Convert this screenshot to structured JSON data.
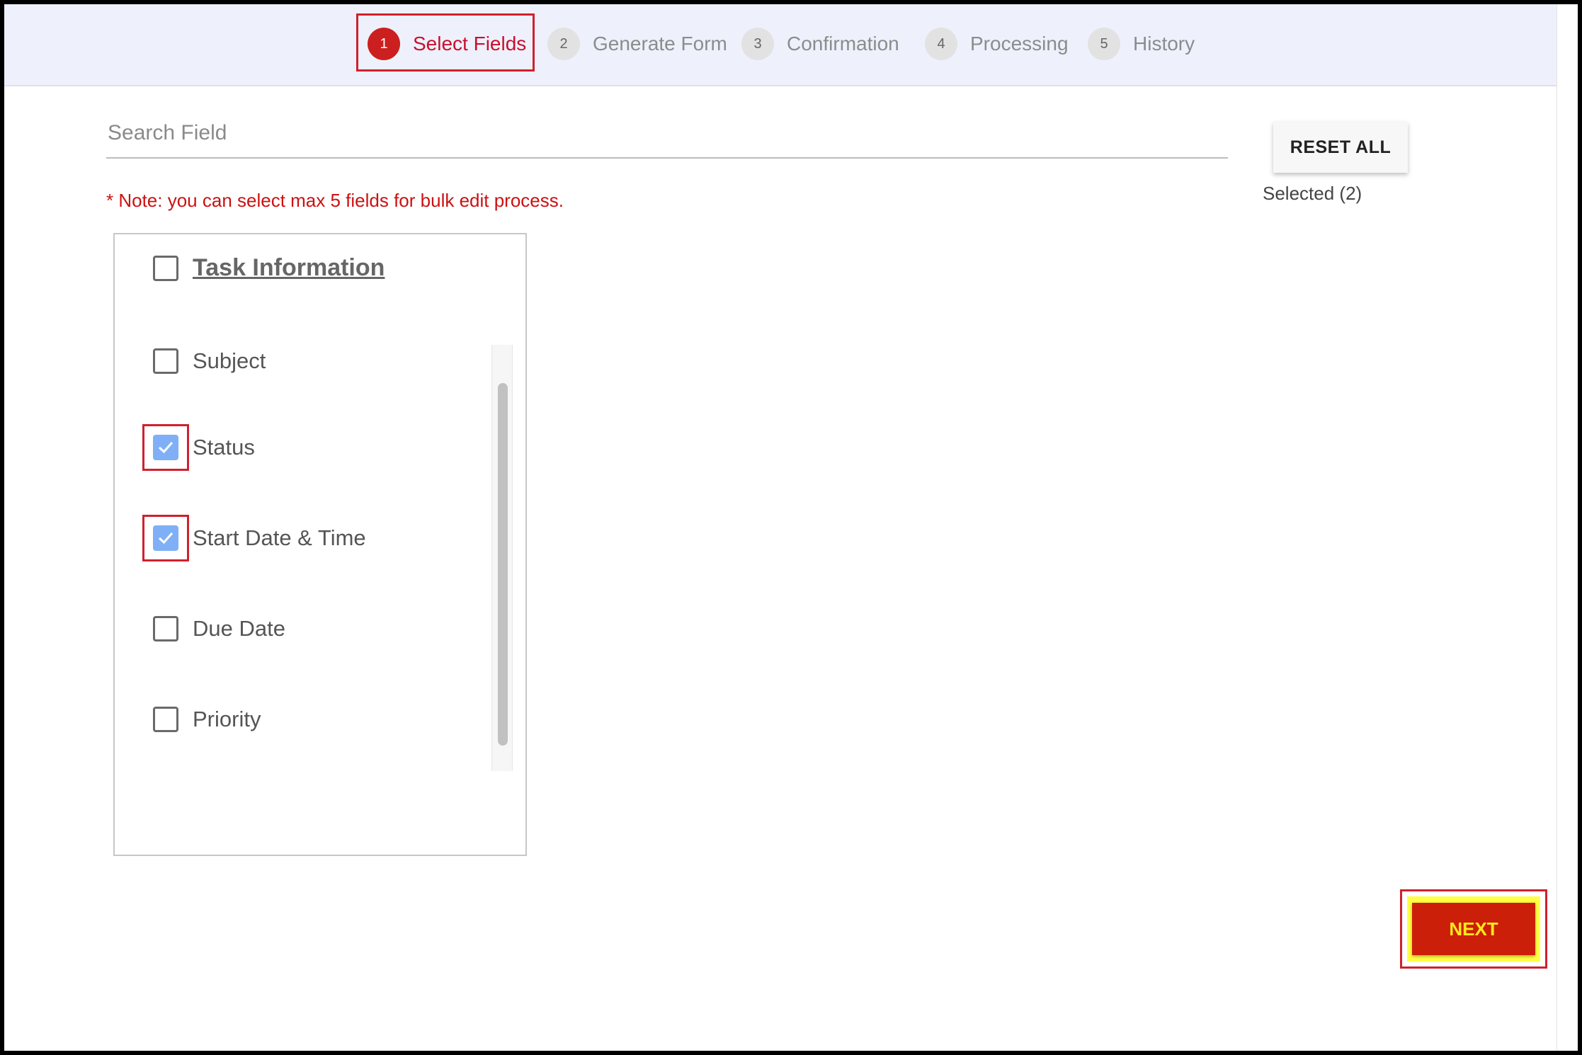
{
  "stepper": {
    "steps": [
      {
        "number": "1",
        "label": "Select Fields",
        "active": true
      },
      {
        "number": "2",
        "label": "Generate Form",
        "active": false
      },
      {
        "number": "3",
        "label": "Confirmation",
        "active": false
      },
      {
        "number": "4",
        "label": "Processing",
        "active": false
      },
      {
        "number": "5",
        "label": "History",
        "active": false
      }
    ]
  },
  "search": {
    "placeholder": "Search Field",
    "value": ""
  },
  "reset_all_label": "RESET ALL",
  "selected_label": "Selected (2)",
  "note": "* Note: you can select max 5 fields for bulk edit process.",
  "field_group": {
    "title": "Task Information",
    "checked": false,
    "fields": [
      {
        "label": "Subject",
        "checked": false
      },
      {
        "label": "Status",
        "checked": true
      },
      {
        "label": "Start Date & Time",
        "checked": true
      },
      {
        "label": "Due Date",
        "checked": false
      },
      {
        "label": "Priority",
        "checked": false
      }
    ]
  },
  "next_label": "NEXT",
  "colors": {
    "accent_red": "#cc1f1f",
    "checkbox_checked": "#7fb0f7",
    "stepper_bg": "#eef1fc",
    "next_button_bg": "#cc1f0a",
    "next_button_text": "#ffe81a",
    "note_text": "#cc1111"
  }
}
